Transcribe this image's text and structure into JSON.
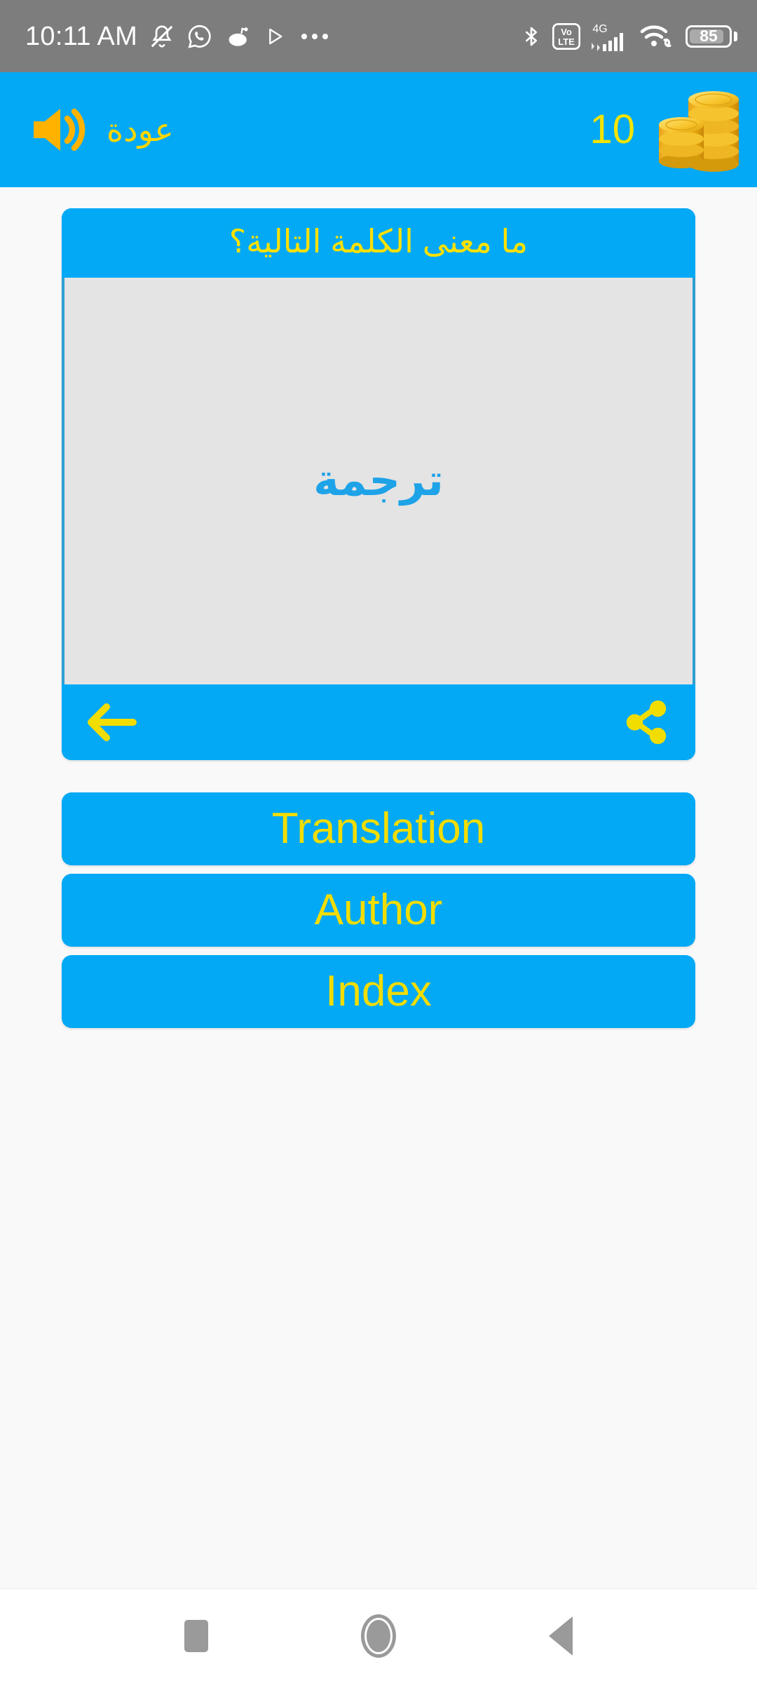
{
  "status_bar": {
    "time": "10:11 AM",
    "battery_percent": "85",
    "network_label_top": "4G",
    "volte_top": "Vo",
    "volte_bottom": "LTE",
    "icons": [
      "bell-muted-icon",
      "whatsapp-icon",
      "reddit-icon",
      "play-send-icon",
      "overflow-dots-icon",
      "bluetooth-icon",
      "volte-icon",
      "signal-4g-icon",
      "wifi-link-icon",
      "battery-icon"
    ]
  },
  "app_bar": {
    "back_label": "عودة",
    "speaker_icon": "volume-speaker-icon",
    "coin_count": "10",
    "coins_icon": "gold-coins-stack-icon"
  },
  "question_card": {
    "header_text": "ما معنى الكلمة التالية؟",
    "word": "ترجمة",
    "prev_icon": "arrow-left-icon",
    "share_icon": "share-icon"
  },
  "answers": [
    {
      "label": "Translation"
    },
    {
      "label": "Author"
    },
    {
      "label": "Index"
    }
  ],
  "nav_bar": {
    "recents": "recents-square-icon",
    "home": "home-circle-icon",
    "back": "back-triangle-icon"
  },
  "colors": {
    "primary_blue": "#03A9F5",
    "accent_yellow": "#F2DD00",
    "header_yellow": "#FFE100",
    "card_gray": "#E4E4E4",
    "word_blue": "#1EA3E8",
    "page_bg": "#F9F9FA",
    "status_gray": "#7D7D7D"
  }
}
